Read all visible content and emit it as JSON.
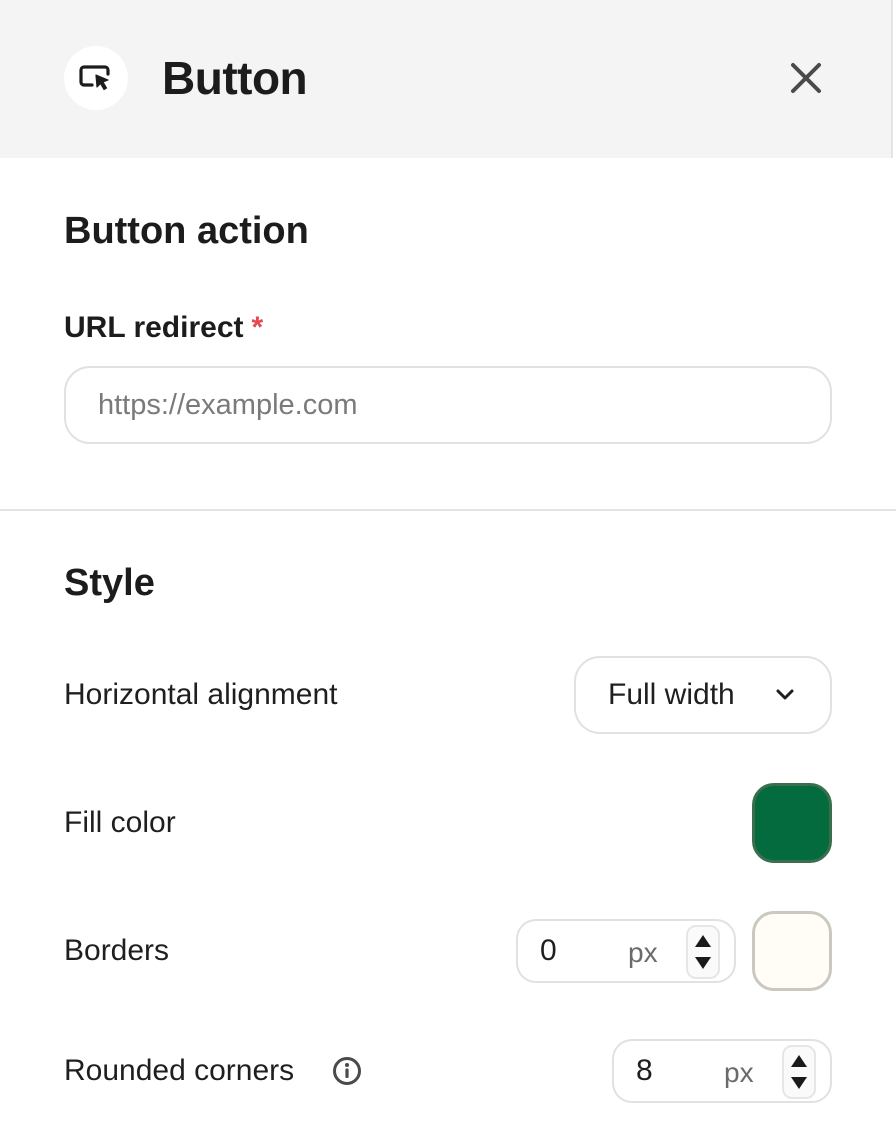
{
  "header": {
    "title": "Button",
    "icon": "cursor-click-icon",
    "close_icon": "close-icon"
  },
  "action_section": {
    "title": "Button action",
    "url_field": {
      "label": "URL redirect",
      "required_marker": "*",
      "value": "",
      "placeholder": "https://example.com"
    }
  },
  "style_section": {
    "title": "Style",
    "horizontal_alignment": {
      "label": "Horizontal alignment",
      "value": "Full width"
    },
    "fill_color": {
      "label": "Fill color",
      "color": "#036b3d"
    },
    "borders": {
      "label": "Borders",
      "value": "0",
      "unit": "px",
      "color": "#fffdf5"
    },
    "rounded_corners": {
      "label": "Rounded corners",
      "value": "8",
      "unit": "px",
      "info_icon": "info-icon"
    }
  },
  "colors": {
    "required": "#e5484d",
    "header_bg": "#f4f4f4"
  }
}
